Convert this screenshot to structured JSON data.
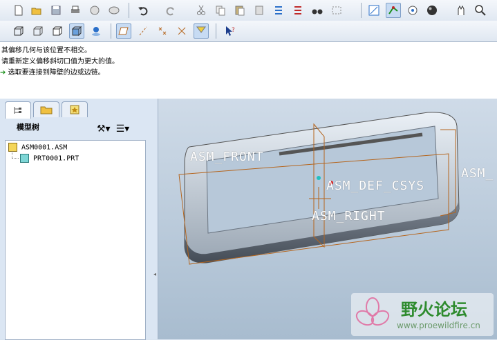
{
  "messages": [
    "其偏移几何与该位置不相交。",
    "请重新定义偏移斜切口值为更大的值。",
    "选取要连接到障壁的边或边链。"
  ],
  "tree": {
    "header": "模型树",
    "root": "ASM0001.ASM",
    "child": "PRT0001.PRT"
  },
  "datums": {
    "front": "ASM_FRONT",
    "csys": "ASM_DEF_CSYS",
    "right": "ASM_RIGHT",
    "top": "ASM_"
  },
  "watermark": {
    "brand": "野火论坛",
    "url": "www.proewildfire.cn"
  },
  "colors": {
    "accent": "#2a6fc9",
    "datum_plane": "#b5651d",
    "brand": "#2e8b2e"
  },
  "icons": [
    "new-icon",
    "open-icon",
    "save-icon",
    "print-icon",
    "undo-icon",
    "redo-icon",
    "cut-icon",
    "copy-icon",
    "paste-icon",
    "binoculars-icon",
    "zoom-icon",
    "spin-icon"
  ]
}
